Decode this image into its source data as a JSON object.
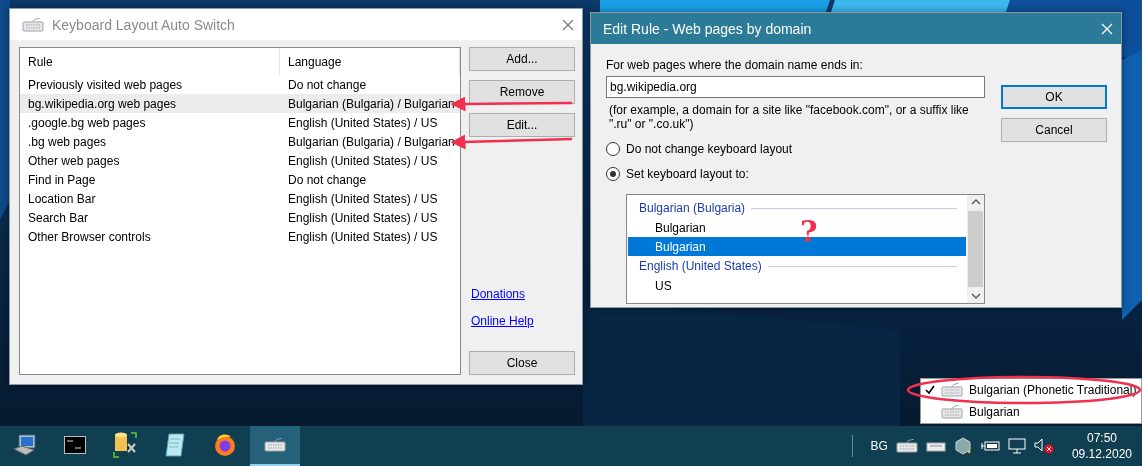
{
  "main_window": {
    "title": "Keyboard Layout Auto Switch",
    "columns": [
      "Rule",
      "Language"
    ],
    "rows": [
      {
        "rule": "Previously visited web pages",
        "language": "Do not change",
        "selected": false
      },
      {
        "rule": "bg.wikipedia.org web pages",
        "language": "Bulgarian (Bulgaria) / Bulgarian",
        "selected": true
      },
      {
        "rule": ".google.bg web pages",
        "language": "English (United States) / US",
        "selected": false
      },
      {
        "rule": ".bg web pages",
        "language": "Bulgarian (Bulgaria) / Bulgarian",
        "selected": false
      },
      {
        "rule": "Other web pages",
        "language": "English (United States) / US",
        "selected": false
      },
      {
        "rule": "Find in Page",
        "language": "Do not change",
        "selected": false
      },
      {
        "rule": "Location Bar",
        "language": "English (United States) / US",
        "selected": false
      },
      {
        "rule": "Search Bar",
        "language": "English (United States) / US",
        "selected": false
      },
      {
        "rule": "Other Browser controls",
        "language": "English (United States) / US",
        "selected": false
      }
    ],
    "buttons": [
      "Add...",
      "Remove",
      "Edit..."
    ],
    "links": [
      "Donations",
      "Online Help"
    ],
    "close_button": "Close"
  },
  "edit_dialog": {
    "title": "Edit Rule - Web pages by domain",
    "domain_label": "For web pages where the domain name ends in:",
    "domain_value": "bg.wikipedia.org",
    "hint": "(for example, a domain for a site like \"facebook.com\", or a suffix like \".ru\" or \".co.uk\")",
    "options": [
      {
        "label": "Do not change keyboard layout",
        "selected": false
      },
      {
        "label": "Set keyboard layout to:",
        "selected": true
      }
    ],
    "layout_groups": [
      {
        "name": "Bulgarian (Bulgaria)",
        "items": [
          {
            "label": "Bulgarian",
            "selected": false
          },
          {
            "label": "Bulgarian",
            "selected": true
          }
        ]
      },
      {
        "name": "English (United States)",
        "items": [
          {
            "label": "US",
            "selected": false
          }
        ]
      }
    ],
    "buttons": [
      {
        "label": "OK",
        "default": true
      },
      {
        "label": "Cancel",
        "default": false
      }
    ]
  },
  "annotations": {
    "question_mark": "?"
  },
  "layout_menu": {
    "items": [
      {
        "label": "Bulgarian (Phonetic Traditional)",
        "checked": true
      },
      {
        "label": "Bulgarian",
        "checked": false
      }
    ]
  },
  "taskbar": {
    "apps": [
      {
        "kind": "computer",
        "active": false
      },
      {
        "kind": "terminal",
        "active": false
      },
      {
        "kind": "database",
        "active": false
      },
      {
        "kind": "notepad",
        "active": false
      },
      {
        "kind": "firefox",
        "active": false
      },
      {
        "kind": "keyboard",
        "active": true
      }
    ],
    "tray": {
      "language": "BG",
      "time": "07:50",
      "date": "09.12.2020"
    }
  }
}
